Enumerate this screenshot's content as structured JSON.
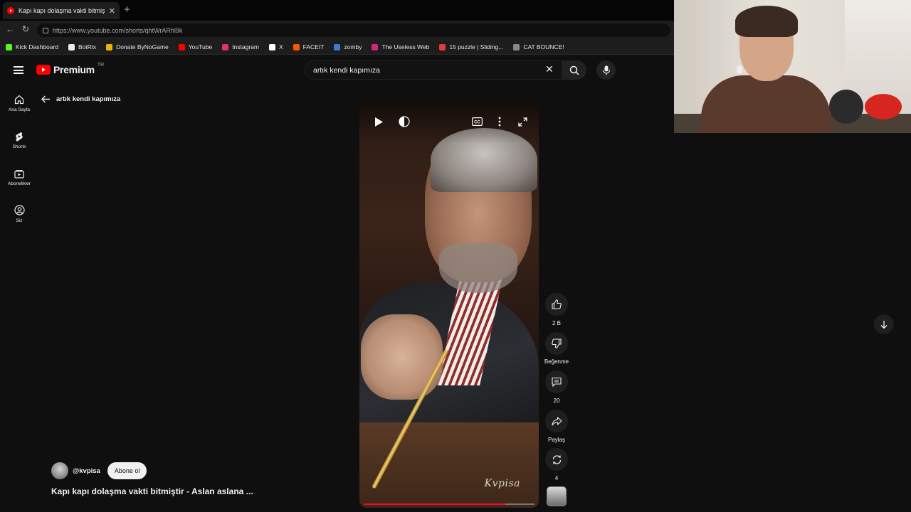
{
  "browser": {
    "tab_title": "Kapı kapı dolaşma vakti bitmiştir",
    "url": "https://www.youtube.com/shorts/qhtWrARhl9k",
    "bookmarks": [
      {
        "label": "Kick Dashboard",
        "color": "#53fc18"
      },
      {
        "label": "BotRix",
        "color": "#eeeeee"
      },
      {
        "label": "Donate ByNoGame",
        "color": "#f0b400"
      },
      {
        "label": "YouTube",
        "color": "#ff0000"
      },
      {
        "label": "Instagram",
        "color": "#e1306c"
      },
      {
        "label": "X",
        "color": "#ffffff"
      },
      {
        "label": "FACEIT",
        "color": "#ff5500"
      },
      {
        "label": "zomby",
        "color": "#3a7bd5"
      },
      {
        "label": "The Useless Web",
        "color": "#d6267c"
      },
      {
        "label": "15 puzzle | Sliding...",
        "color": "#e53935"
      },
      {
        "label": "CAT BOUNCE!",
        "color": "#888888"
      }
    ]
  },
  "youtube": {
    "logo_text": "Premium",
    "country_code": "TR",
    "search_query": "artık kendi kapımıza",
    "back_label": "artık kendi kapımıza",
    "sidenav": [
      {
        "label": "Ana Sayfa",
        "icon": "home-icon"
      },
      {
        "label": "Shorts",
        "icon": "shorts-icon"
      },
      {
        "label": "Abonelikler",
        "icon": "subscriptions-icon"
      },
      {
        "label": "Siz",
        "icon": "you-icon"
      }
    ]
  },
  "short": {
    "watermark": "Kvpisa",
    "progress_fraction": 0.83,
    "likes": "2 B",
    "dislike_label": "Beğenme",
    "comments": "20",
    "share_label": "Paylaş",
    "remix_count": "4",
    "channel_handle": "@kvpisa",
    "subscribe_label": "Abone ol",
    "title": "Kapı kapı dolaşma vakti bitmiştir - Aslan aslana ..."
  },
  "colors": {
    "brand_red": "#ff0000",
    "progress_red": "#ff0033",
    "background": "#0f0f0f"
  }
}
